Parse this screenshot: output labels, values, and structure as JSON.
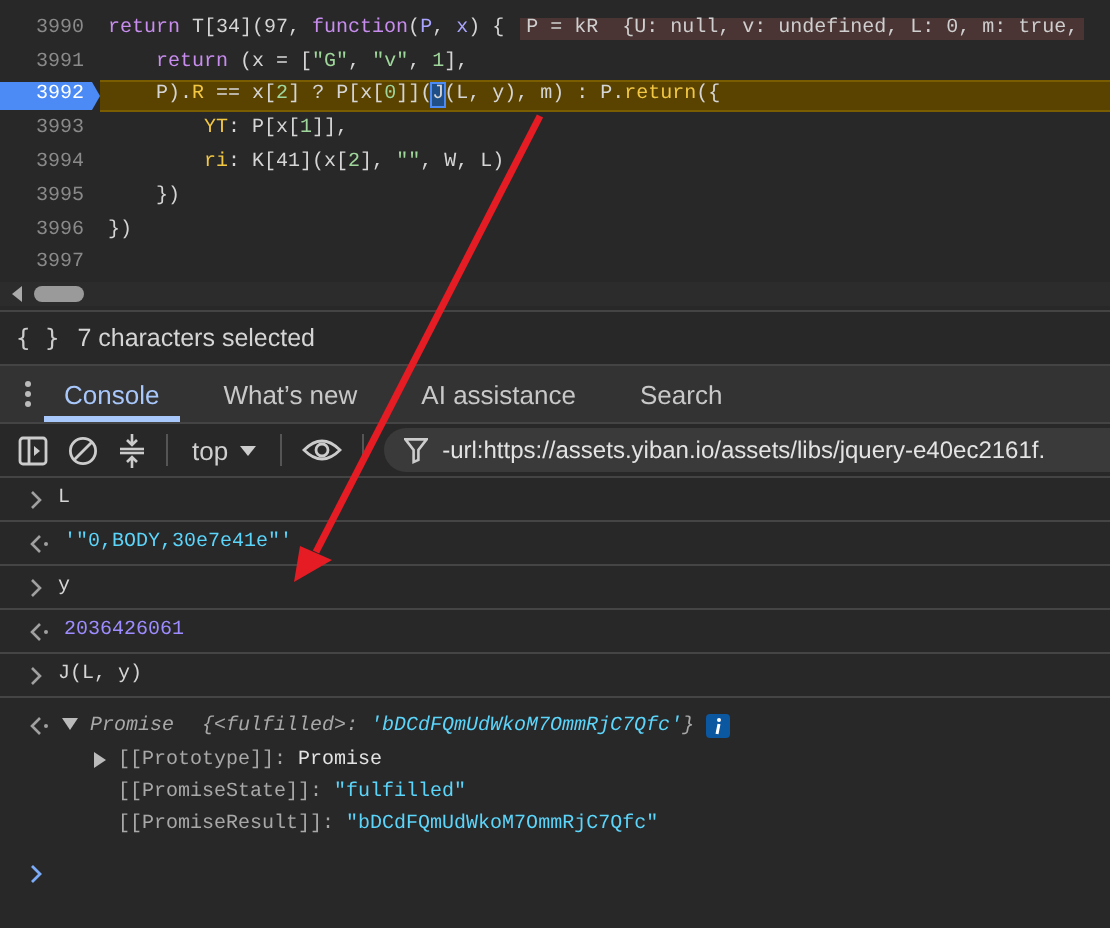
{
  "editor": {
    "lines": [
      {
        "number": "3990",
        "paused": false,
        "tokens": [
          {
            "kind": "keyword",
            "text": "return"
          },
          {
            "kind": "plain",
            "text": " T[34](97, "
          },
          {
            "kind": "keyword",
            "text": "function"
          },
          {
            "kind": "plain",
            "text": "("
          },
          {
            "kind": "param",
            "text": "P"
          },
          {
            "kind": "plain",
            "text": ", "
          },
          {
            "kind": "param",
            "text": "x"
          },
          {
            "kind": "plain",
            "text": ") {"
          }
        ],
        "inline_value": "P = kR  {U: null, v: undefined, L: 0, m: true,"
      },
      {
        "number": "3991",
        "paused": false,
        "tokens": [
          {
            "kind": "keyword",
            "text": "    return"
          },
          {
            "kind": "plain",
            "text": " (x = ["
          },
          {
            "kind": "string",
            "text": "\"G\""
          },
          {
            "kind": "plain",
            "text": ", "
          },
          {
            "kind": "string",
            "text": "\"v\""
          },
          {
            "kind": "plain",
            "text": ", "
          },
          {
            "kind": "number",
            "text": "1"
          },
          {
            "kind": "plain",
            "text": "],"
          }
        ]
      },
      {
        "number": "3992",
        "paused": true,
        "tokens": [
          {
            "kind": "plain",
            "text": "    P)."
          },
          {
            "kind": "property",
            "text": "R"
          },
          {
            "kind": "plain",
            "text": " == x["
          },
          {
            "kind": "number",
            "text": "2"
          },
          {
            "kind": "plain",
            "text": "] ? P[x["
          },
          {
            "kind": "number",
            "text": "0"
          },
          {
            "kind": "plain",
            "text": "]]("
          },
          {
            "kind": "selection",
            "text": "J"
          },
          {
            "kind": "plain",
            "text": "(L, y), m) : P."
          },
          {
            "kind": "property",
            "text": "return"
          },
          {
            "kind": "plain",
            "text": "({"
          }
        ]
      },
      {
        "number": "3993",
        "paused": false,
        "tokens": [
          {
            "kind": "property",
            "text": "        YT"
          },
          {
            "kind": "plain",
            "text": ": P[x["
          },
          {
            "kind": "number",
            "text": "1"
          },
          {
            "kind": "plain",
            "text": "]],"
          }
        ]
      },
      {
        "number": "3994",
        "paused": false,
        "tokens": [
          {
            "kind": "property",
            "text": "        ri"
          },
          {
            "kind": "plain",
            "text": ": K[41](x["
          },
          {
            "kind": "number",
            "text": "2"
          },
          {
            "kind": "plain",
            "text": "], "
          },
          {
            "kind": "string",
            "text": "\"\""
          },
          {
            "kind": "plain",
            "text": ", W, L)"
          }
        ]
      },
      {
        "number": "3995",
        "paused": false,
        "tokens": [
          {
            "kind": "plain",
            "text": "    })"
          }
        ]
      },
      {
        "number": "3996",
        "paused": false,
        "tokens": [
          {
            "kind": "plain",
            "text": "})"
          }
        ]
      },
      {
        "number": "3997",
        "paused": false
      }
    ]
  },
  "status_bar": {
    "icon": "{ }",
    "text": "7 characters selected"
  },
  "drawer_tabs": [
    {
      "label": "Console",
      "selected": true
    },
    {
      "label": "What’s new",
      "selected": false
    },
    {
      "label": "AI assistance",
      "selected": false
    },
    {
      "label": "Search",
      "selected": false
    }
  ],
  "console_toolbar": {
    "context": "top",
    "filter": "-url:https://assets.yiban.io/assets/libs/jquery-e40ec2161f."
  },
  "console_messages": [
    {
      "kind": "input",
      "text": "L"
    },
    {
      "kind": "string",
      "text": "'\"0,BODY,30e7e41e\"'"
    },
    {
      "kind": "input",
      "text": "y"
    },
    {
      "kind": "number",
      "text": "2036426061"
    },
    {
      "kind": "input",
      "text": "J(L, y)"
    },
    {
      "kind": "object",
      "label": "Promise",
      "preview_open": "{<fulfilled>: ",
      "preview_value": "'bDCdFQmUdWkoM7OmmRjC7Qfc'",
      "preview_close": "}",
      "expanded": true,
      "properties": [
        {
          "kind": "expandable",
          "expanded": false,
          "key": "[[Prototype]]:",
          "value": "Promise"
        },
        {
          "kind": "string",
          "key": "[[PromiseState]]:",
          "value": "\"fulfilled\""
        },
        {
          "kind": "string",
          "key": "[[PromiseResult]]:",
          "value": "\"bDCdFQmUdWkoM7OmmRjC7Qfc\""
        }
      ]
    }
  ],
  "annotation": {
    "kind": "arrow"
  }
}
